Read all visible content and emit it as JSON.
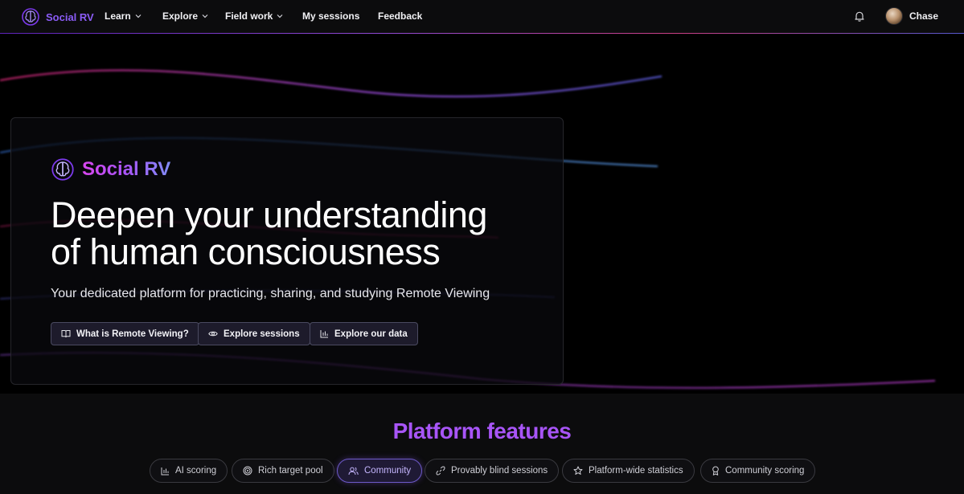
{
  "navbar": {
    "brand": "Social RV",
    "items": [
      {
        "label": "Learn",
        "dropdown": true
      },
      {
        "label": "Explore",
        "dropdown": true
      },
      {
        "label": "Field work",
        "dropdown": true
      },
      {
        "label": "My sessions",
        "dropdown": false
      },
      {
        "label": "Feedback",
        "dropdown": false
      }
    ],
    "user": {
      "name": "Chase"
    }
  },
  "hero": {
    "brand": "Social RV",
    "headline_line1": "Deepen your understanding",
    "headline_line2": "of human consciousness",
    "subheadline": "Your dedicated platform for practicing, sharing, and studying Remote Viewing",
    "buttons": [
      {
        "label": "What is Remote Viewing?",
        "icon": "book-icon"
      },
      {
        "label": "Explore sessions",
        "icon": "eye-icon"
      },
      {
        "label": "Explore our data",
        "icon": "bar-chart-icon"
      }
    ]
  },
  "features": {
    "title": "Platform features",
    "tabs": [
      {
        "label": "AI scoring",
        "icon": "bar-chart-icon",
        "active": false
      },
      {
        "label": "Rich target pool",
        "icon": "target-icon",
        "active": false
      },
      {
        "label": "Community",
        "icon": "users-icon",
        "active": true
      },
      {
        "label": "Provably blind sessions",
        "icon": "link-icon",
        "active": false
      },
      {
        "label": "Platform-wide statistics",
        "icon": "star-icon",
        "active": false
      },
      {
        "label": "Community scoring",
        "icon": "award-icon",
        "active": false
      }
    ]
  },
  "colors": {
    "accent": "#a855f7",
    "brand_nav": "#8b5cf6",
    "background": "#000000",
    "nav_background": "#0c0c0d"
  }
}
